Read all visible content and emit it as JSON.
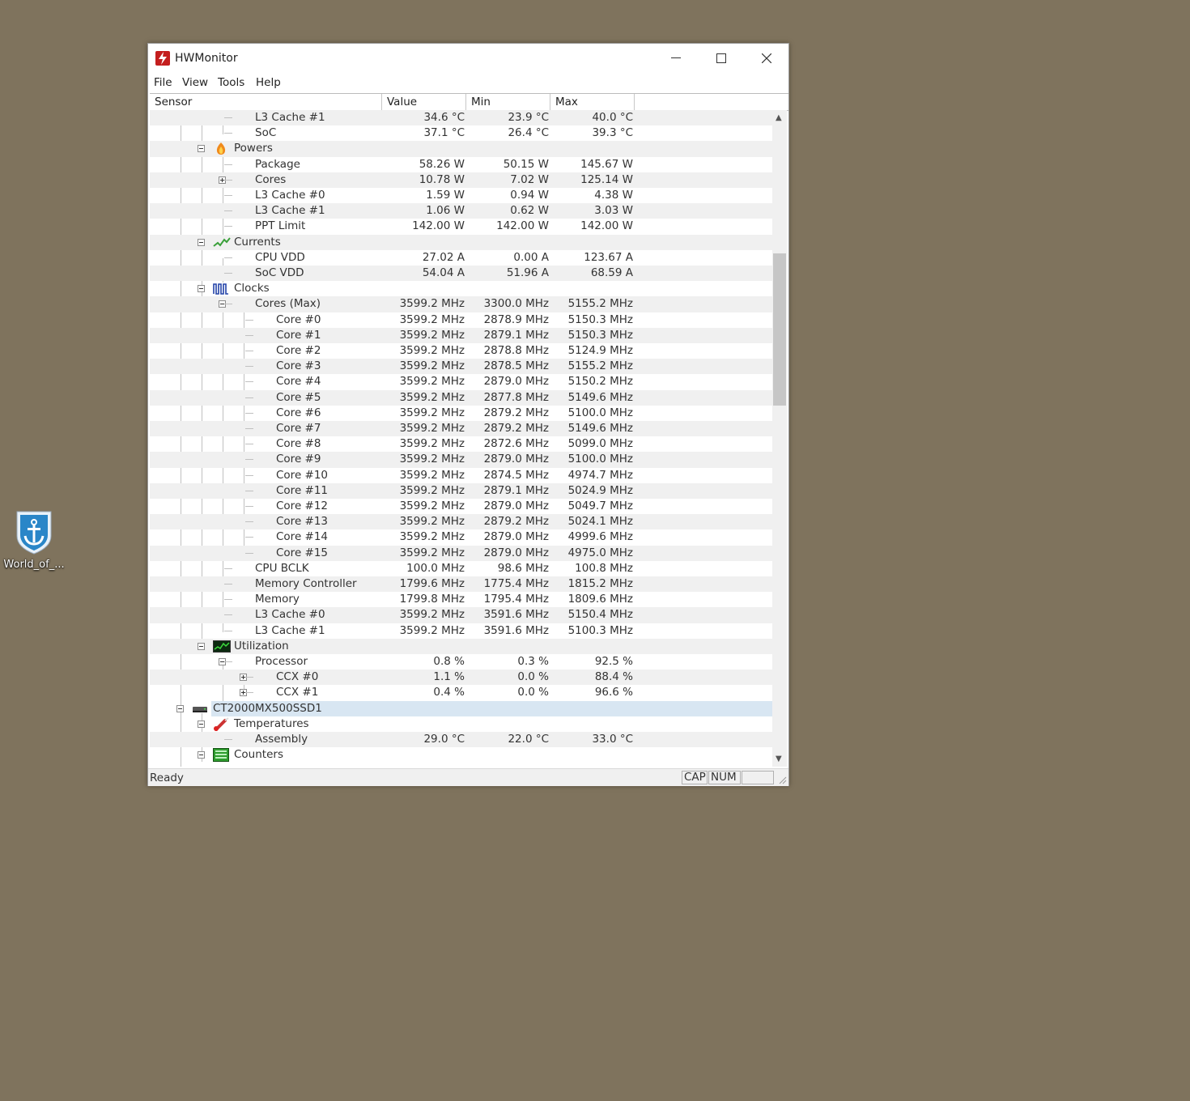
{
  "desktop": {
    "icon_label": "World_of_..."
  },
  "window": {
    "title": "HWMonitor"
  },
  "menu": [
    "File",
    "View",
    "Tools",
    "Help"
  ],
  "columns": {
    "sensor": "Sensor",
    "value": "Value",
    "min": "Min",
    "max": "Max"
  },
  "rows": [
    {
      "name": "L3 Cache #1",
      "value": "34.6 °C",
      "min": "23.9 °C",
      "max": "40.0 °C"
    },
    {
      "name": "SoC",
      "value": "37.1 °C",
      "min": "26.4 °C",
      "max": "39.3 °C"
    },
    {
      "name": "Powers",
      "icon": "power-icon",
      "group": true
    },
    {
      "name": "Package",
      "value": "58.26 W",
      "min": "50.15 W",
      "max": "145.67 W"
    },
    {
      "name": "Cores",
      "value": "10.78 W",
      "min": "7.02 W",
      "max": "125.14 W",
      "plus": true
    },
    {
      "name": "L3 Cache #0",
      "value": "1.59 W",
      "min": "0.94 W",
      "max": "4.38 W"
    },
    {
      "name": "L3 Cache #1",
      "value": "1.06 W",
      "min": "0.62 W",
      "max": "3.03 W"
    },
    {
      "name": "PPT Limit",
      "value": "142.00 W",
      "min": "142.00 W",
      "max": "142.00 W"
    },
    {
      "name": "Currents",
      "icon": "current-icon",
      "group": true
    },
    {
      "name": "CPU VDD",
      "value": "27.02 A",
      "min": "0.00 A",
      "max": "123.67 A"
    },
    {
      "name": "SoC VDD",
      "value": "54.04 A",
      "min": "51.96 A",
      "max": "68.59 A"
    },
    {
      "name": "Clocks",
      "icon": "clock-icon",
      "group": true
    },
    {
      "name": "Cores (Max)",
      "value": "3599.2 MHz",
      "min": "3300.0 MHz",
      "max": "5155.2 MHz",
      "minus": true
    },
    {
      "name": "Core #0",
      "value": "3599.2 MHz",
      "min": "2878.9 MHz",
      "max": "5150.3 MHz",
      "sub": true
    },
    {
      "name": "Core #1",
      "value": "3599.2 MHz",
      "min": "2879.1 MHz",
      "max": "5150.3 MHz",
      "sub": true
    },
    {
      "name": "Core #2",
      "value": "3599.2 MHz",
      "min": "2878.8 MHz",
      "max": "5124.9 MHz",
      "sub": true
    },
    {
      "name": "Core #3",
      "value": "3599.2 MHz",
      "min": "2878.5 MHz",
      "max": "5155.2 MHz",
      "sub": true
    },
    {
      "name": "Core #4",
      "value": "3599.2 MHz",
      "min": "2879.0 MHz",
      "max": "5150.2 MHz",
      "sub": true
    },
    {
      "name": "Core #5",
      "value": "3599.2 MHz",
      "min": "2877.8 MHz",
      "max": "5149.6 MHz",
      "sub": true
    },
    {
      "name": "Core #6",
      "value": "3599.2 MHz",
      "min": "2879.2 MHz",
      "max": "5100.0 MHz",
      "sub": true
    },
    {
      "name": "Core #7",
      "value": "3599.2 MHz",
      "min": "2879.2 MHz",
      "max": "5149.6 MHz",
      "sub": true
    },
    {
      "name": "Core #8",
      "value": "3599.2 MHz",
      "min": "2872.6 MHz",
      "max": "5099.0 MHz",
      "sub": true
    },
    {
      "name": "Core #9",
      "value": "3599.2 MHz",
      "min": "2879.0 MHz",
      "max": "5100.0 MHz",
      "sub": true
    },
    {
      "name": "Core #10",
      "value": "3599.2 MHz",
      "min": "2874.5 MHz",
      "max": "4974.7 MHz",
      "sub": true
    },
    {
      "name": "Core #11",
      "value": "3599.2 MHz",
      "min": "2879.1 MHz",
      "max": "5024.9 MHz",
      "sub": true
    },
    {
      "name": "Core #12",
      "value": "3599.2 MHz",
      "min": "2879.0 MHz",
      "max": "5049.7 MHz",
      "sub": true
    },
    {
      "name": "Core #13",
      "value": "3599.2 MHz",
      "min": "2879.2 MHz",
      "max": "5024.1 MHz",
      "sub": true
    },
    {
      "name": "Core #14",
      "value": "3599.2 MHz",
      "min": "2879.0 MHz",
      "max": "4999.6 MHz",
      "sub": true
    },
    {
      "name": "Core #15",
      "value": "3599.2 MHz",
      "min": "2879.0 MHz",
      "max": "4975.0 MHz",
      "sub": true
    },
    {
      "name": "CPU BCLK",
      "value": "100.0 MHz",
      "min": "98.6 MHz",
      "max": "100.8 MHz"
    },
    {
      "name": "Memory Controller",
      "value": "1799.6 MHz",
      "min": "1775.4 MHz",
      "max": "1815.2 MHz"
    },
    {
      "name": "Memory",
      "value": "1799.8 MHz",
      "min": "1795.4 MHz",
      "max": "1809.6 MHz"
    },
    {
      "name": "L3 Cache #0",
      "value": "3599.2 MHz",
      "min": "3591.6 MHz",
      "max": "5150.4 MHz"
    },
    {
      "name": "L3 Cache #1",
      "value": "3599.2 MHz",
      "min": "3591.6 MHz",
      "max": "5100.3 MHz"
    },
    {
      "name": "Utilization",
      "icon": "utilization-icon",
      "group": true
    },
    {
      "name": "Processor",
      "value": "0.8 %",
      "min": "0.3 %",
      "max": "92.5 %",
      "minus": true
    },
    {
      "name": "CCX #0",
      "value": "1.1 %",
      "min": "0.0 %",
      "max": "88.4 %",
      "sub": true,
      "plus": true
    },
    {
      "name": "CCX #1",
      "value": "0.4 %",
      "min": "0.0 %",
      "max": "96.6 %",
      "sub": true,
      "plus": true
    },
    {
      "name": "CT2000MX500SSD1",
      "icon": "drive-icon",
      "device": true
    },
    {
      "name": "Temperatures",
      "icon": "thermometer-icon",
      "group": true
    },
    {
      "name": "Assembly",
      "value": "29.0 °C",
      "min": "22.0 °C",
      "max": "33.0 °C"
    },
    {
      "name": "Counters",
      "icon": "counter-icon",
      "group": true
    }
  ],
  "status": {
    "text": "Ready",
    "cap": "CAP",
    "num": "NUM"
  },
  "colors": {
    "desktop": "#7f735d",
    "selection": "#d8e6f2",
    "app_icon": "#c41e1e"
  }
}
